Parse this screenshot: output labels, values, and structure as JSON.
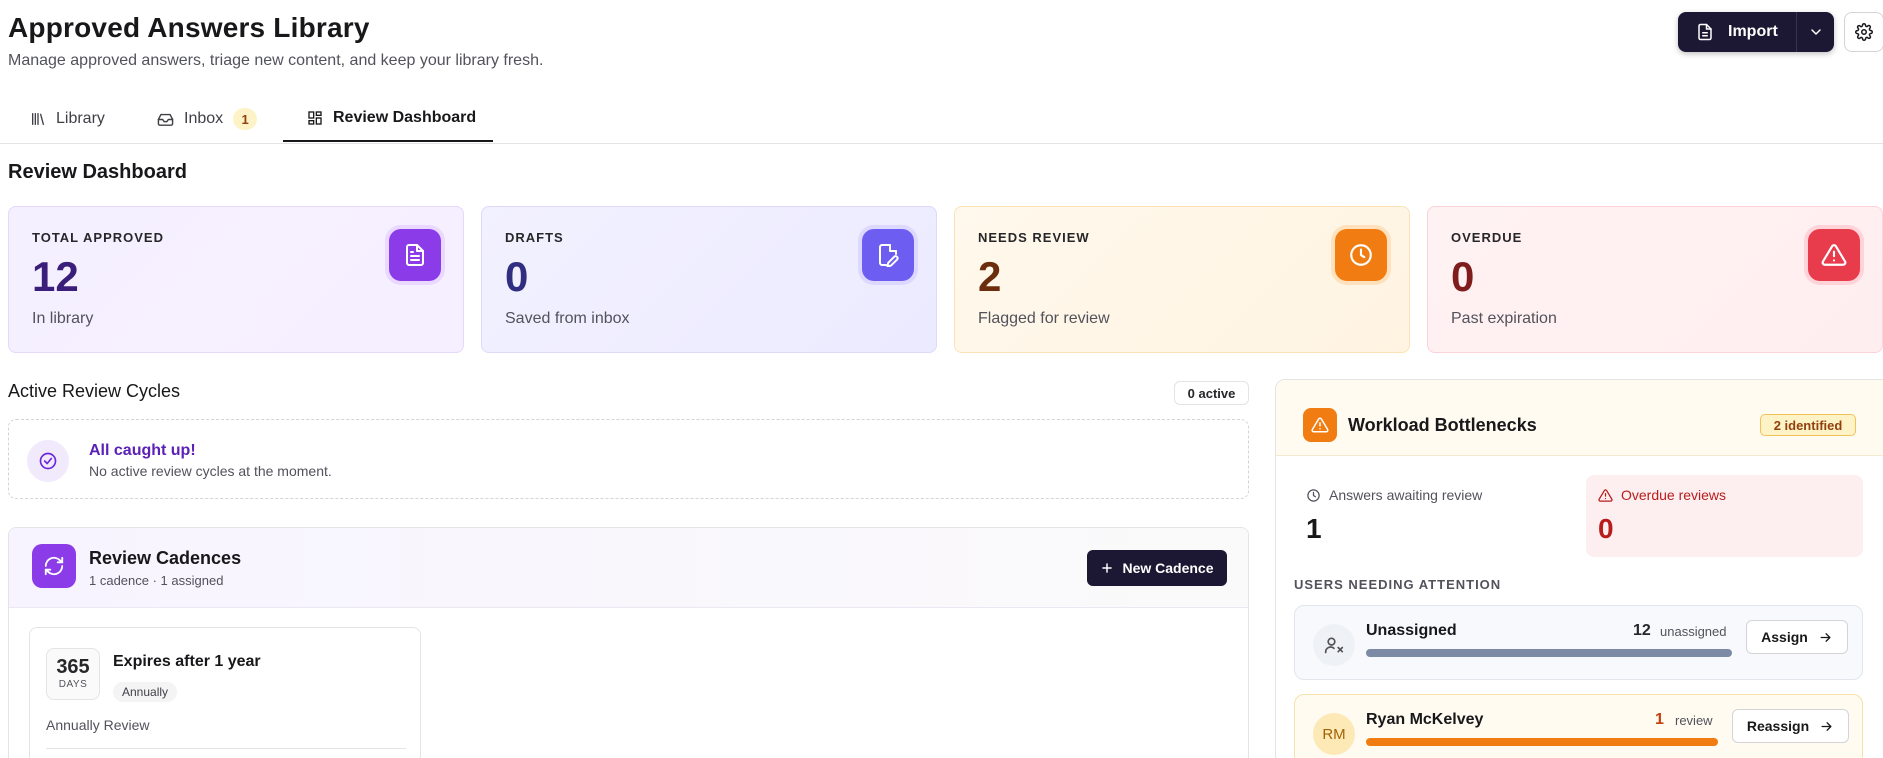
{
  "header": {
    "title": "Approved Answers Library",
    "subtitle": "Manage approved answers, triage new content, and keep your library fresh.",
    "import_label": "Import"
  },
  "tabs": [
    {
      "label": "Library",
      "icon": "library-icon"
    },
    {
      "label": "Inbox",
      "icon": "inbox-icon",
      "badge": "1"
    },
    {
      "label": "Review Dashboard",
      "icon": "dashboard-icon",
      "active": true
    }
  ],
  "dashboard": {
    "title": "Review Dashboard",
    "stats": [
      {
        "label": "TOTAL APPROVED",
        "value": "12",
        "sub": "In library",
        "icon": "document-icon"
      },
      {
        "label": "DRAFTS",
        "value": "0",
        "sub": "Saved from inbox",
        "icon": "edit-document-icon"
      },
      {
        "label": "NEEDS REVIEW",
        "value": "2",
        "sub": "Flagged for review",
        "icon": "clock-icon"
      },
      {
        "label": "OVERDUE",
        "value": "0",
        "sub": "Past expiration",
        "icon": "warning-icon"
      }
    ]
  },
  "cycles": {
    "title": "Active Review Cycles",
    "badge": "0 active",
    "empty_title": "All caught up!",
    "empty_text": "No active review cycles at the moment."
  },
  "cadences": {
    "title": "Review Cadences",
    "summary": "1 cadence · 1 assigned",
    "new_label": "New Cadence",
    "items": [
      {
        "days": "365",
        "days_unit": "DAYS",
        "title": "Expires after 1 year",
        "chip": "Annually",
        "desc": "Annually Review"
      }
    ]
  },
  "workload": {
    "title": "Workload Bottlenecks",
    "badge": "2 identified",
    "awaiting_label": "Answers awaiting review",
    "awaiting_value": "1",
    "overdue_label": "Overdue reviews",
    "overdue_value": "0",
    "users_label": "USERS NEEDING ATTENTION",
    "users": [
      {
        "name": "Unassigned",
        "initials": "",
        "count": "12",
        "unit": "unassigned",
        "action": "Assign",
        "load": 1.0
      },
      {
        "name": "Ryan McKelvey",
        "initials": "RM",
        "count": "1",
        "unit": "review",
        "action": "Reassign",
        "load": 1.0
      }
    ]
  },
  "colors": {
    "primary": "#1c1732",
    "purple": "#8b3be8",
    "orange": "#f07c12",
    "red": "#e83b4c"
  }
}
